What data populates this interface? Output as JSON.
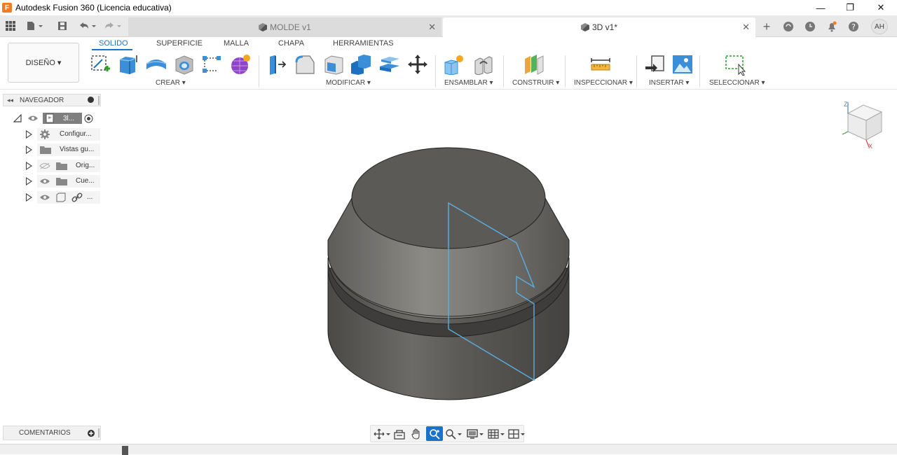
{
  "window": {
    "title": "Autodesk Fusion 360 (Licencia educativa)",
    "app_icon_letter": "F",
    "minimize": "—",
    "restore": "❐",
    "close": "✕"
  },
  "tabs": {
    "inactive": {
      "label": "MOLDE v1",
      "close": "✕"
    },
    "active": {
      "label": "3D v1*",
      "close": "✕"
    }
  },
  "user": {
    "initials": "AH"
  },
  "toolbar": {
    "workspace": "DISEÑO ▾",
    "workspace_tabs": [
      "SOLIDO",
      "SUPERFICIE",
      "MALLA",
      "CHAPA",
      "HERRAMIENTAS"
    ],
    "groups": {
      "crear": "CREAR ▾",
      "modificar": "MODIFICAR ▾",
      "ensamblar": "ENSAMBLAR ▾",
      "construir": "CONSTRUIR ▾",
      "inspeccionar": "INSPECCIONAR ▾",
      "insertar": "INSERTAR ▾",
      "seleccionar": "SELECCIONAR ▾"
    },
    "accent": "#1a73c8"
  },
  "browser": {
    "title": "NAVEGADOR",
    "root_label": "3l...",
    "items": [
      {
        "label": "Configur...",
        "icon": "gear-icon"
      },
      {
        "label": "Vistas gu...",
        "icon": "folder-icon"
      },
      {
        "label": "Orig...",
        "icon": "folder-icon"
      },
      {
        "label": "Cue...",
        "icon": "folder-icon"
      },
      {
        "label": "...",
        "icon": "link-icon"
      }
    ]
  },
  "comments": {
    "title": "COMENTARIOS"
  },
  "viewcube": {
    "axis_z": "Z",
    "axis_x": "X"
  },
  "model": {
    "body_color": "#5b5a57",
    "sketch_color": "#5aaee0"
  }
}
